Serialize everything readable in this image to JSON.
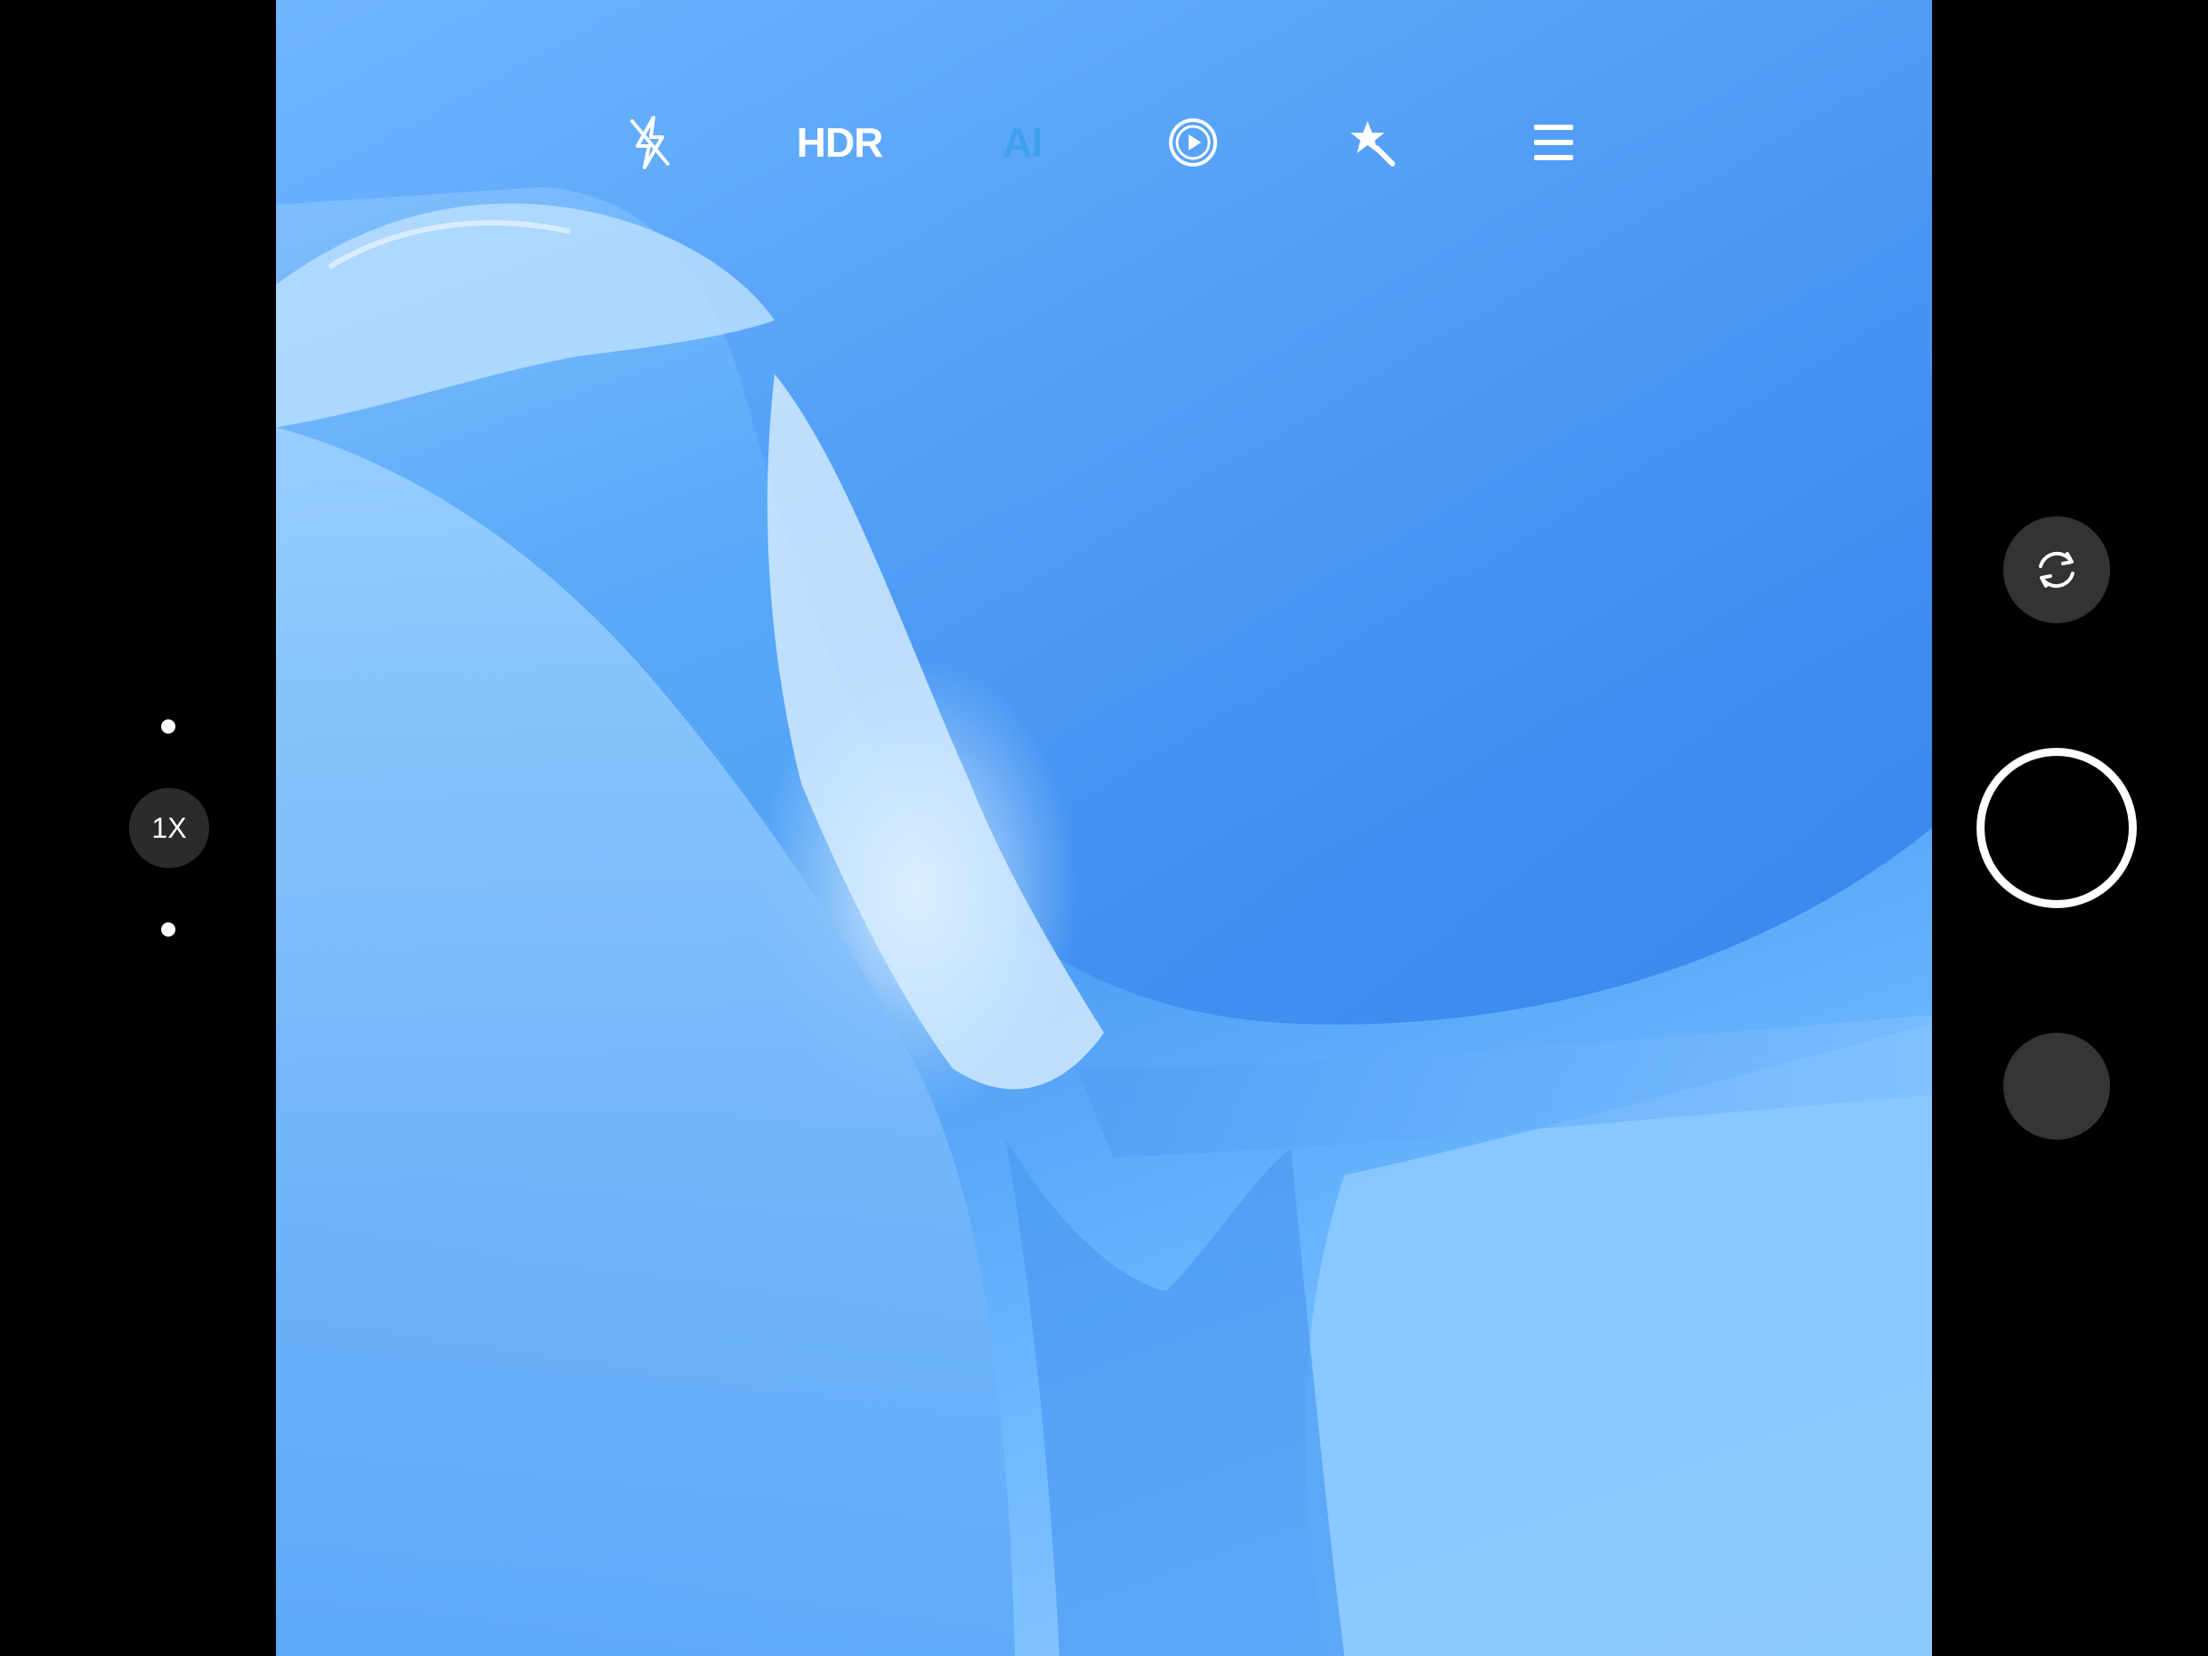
{
  "toolbar": {
    "flash_icon": "flash-off-icon",
    "hdr_label": "HDR",
    "ai_label": "AI",
    "ai_color": "#3fa0f0",
    "live_icon": "motion-photo-icon",
    "beauty_icon": "magic-wand-icon",
    "menu_icon": "hamburger-menu-icon"
  },
  "zoom": {
    "label": "1X"
  },
  "controls": {
    "switch_icon": "switch-camera-icon",
    "shutter_icon": "shutter-icon",
    "gallery_icon": "gallery-thumbnail"
  }
}
